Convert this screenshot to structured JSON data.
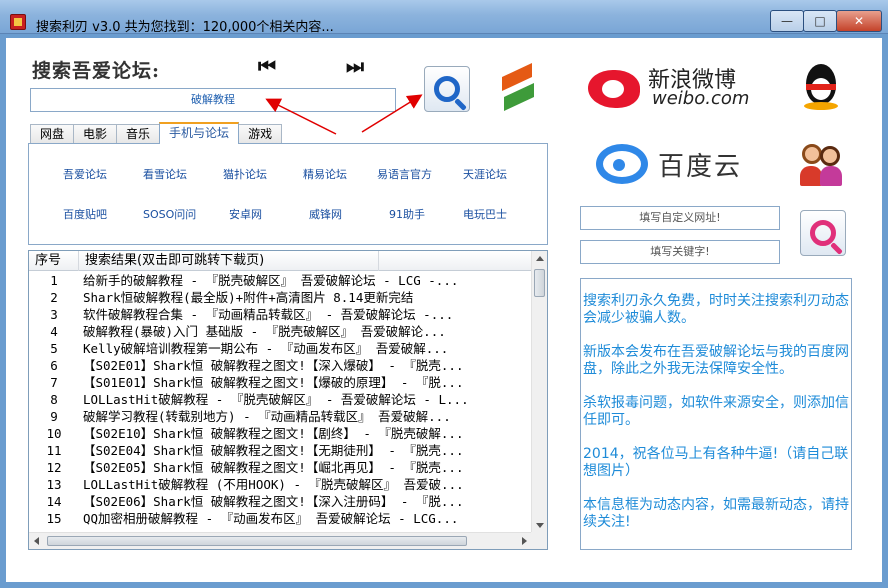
{
  "window": {
    "title": "搜索利刃 v3.0  共为您找到：120,000个相关内容...",
    "min_glyph": "—",
    "max_glyph": "□",
    "close_glyph": "✕"
  },
  "search": {
    "heading": "搜索吾爱论坛:",
    "prev_glyph": "⏮",
    "next_glyph": "⏭",
    "keyword_value": "破解教程"
  },
  "tabs": [
    "网盘",
    "电影",
    "音乐",
    "手机与论坛",
    "游戏"
  ],
  "active_tab": 3,
  "forums": [
    "吾爱论坛",
    "看雪论坛",
    "猫扑论坛",
    "精易论坛",
    "易语言官方",
    "天涯论坛",
    "百度贴吧",
    "SOSO问问",
    "安卓网",
    "威锋网",
    "91助手",
    "电玩巴士"
  ],
  "logos": {
    "weibo_cn": "新浪微博",
    "weibo_en": "weibo.com",
    "baiduyun": "百度云"
  },
  "right_inputs": {
    "custom_url": "填写自定义网址!",
    "keyword": "填写关键字!"
  },
  "results": {
    "col_index": "序号",
    "col_title": "搜索结果(双击即可跳转下载页)",
    "rows": [
      {
        "n": "1",
        "t": "给新手的破解教程 - 『脱壳破解区』 吾爱破解论坛 - LCG -..."
      },
      {
        "n": "2",
        "t": "Shark恒破解教程(最全版)+附件+高清图片 8.14更新完结"
      },
      {
        "n": "3",
        "t": "软件破解教程合集 - 『动画精品转载区』 - 吾爱破解论坛 -..."
      },
      {
        "n": "4",
        "t": "破解教程(暴破)入门 基础版 - 『脱壳破解区』 吾爱破解论..."
      },
      {
        "n": "5",
        "t": "Kelly破解培训教程第一期公布 - 『动画发布区』 吾爱破解..."
      },
      {
        "n": "6",
        "t": "【S02E01】Shark恒 破解教程之图文!【深入爆破】 - 『脱壳..."
      },
      {
        "n": "7",
        "t": "【S01E01】Shark恒 破解教程之图文!【爆破的原理】 - 『脱..."
      },
      {
        "n": "8",
        "t": "LOLLastHit破解教程 - 『脱壳破解区』 - 吾爱破解论坛 - L..."
      },
      {
        "n": "9",
        "t": "破解学习教程(转载别地方) - 『动画精品转载区』 吾爱破解..."
      },
      {
        "n": "10",
        "t": "【S02E10】Shark恒 破解教程之图文!【剧终】 - 『脱壳破解..."
      },
      {
        "n": "11",
        "t": "【S02E04】Shark恒 破解教程之图文!【无期徒刑】 - 『脱壳..."
      },
      {
        "n": "12",
        "t": "【S02E05】Shark恒 破解教程之图文!【崛北再见】 - 『脱壳..."
      },
      {
        "n": "13",
        "t": "LOLLastHit破解教程 (不用HOOK) - 『脱壳破解区』 吾爱破..."
      },
      {
        "n": "14",
        "t": "【S02E06】Shark恒 破解教程之图文!【深入注册码】 - 『脱..."
      },
      {
        "n": "15",
        "t": "QQ加密相册破解教程 - 『动画发布区』 吾爱破解论坛 - LCG..."
      }
    ]
  },
  "info_lines": [
    "搜索利刃永久免费，时时关注搜索利刃动态会减少被骗人数。",
    "新版本会发布在吾爱破解论坛与我的百度网盘，除此之外我无法保障安全性。",
    "杀软报毒问题，如软件来源安全，则添加信任即可。",
    "2014，祝各位马上有各种牛逼!（请自己联想图片）",
    "本信息框为动态内容，如需最新动态，请持续关注!"
  ],
  "colors": {
    "info_text": "#1e8bd8",
    "link_text": "#1a4fa0",
    "tab_accent": "#f0a020",
    "arrow": "#e00000"
  },
  "icons": {
    "search": "magnifier-icon",
    "swap": "swap-arrows-icon",
    "qq": "qq-penguin-icon",
    "friends": "people-icon"
  }
}
